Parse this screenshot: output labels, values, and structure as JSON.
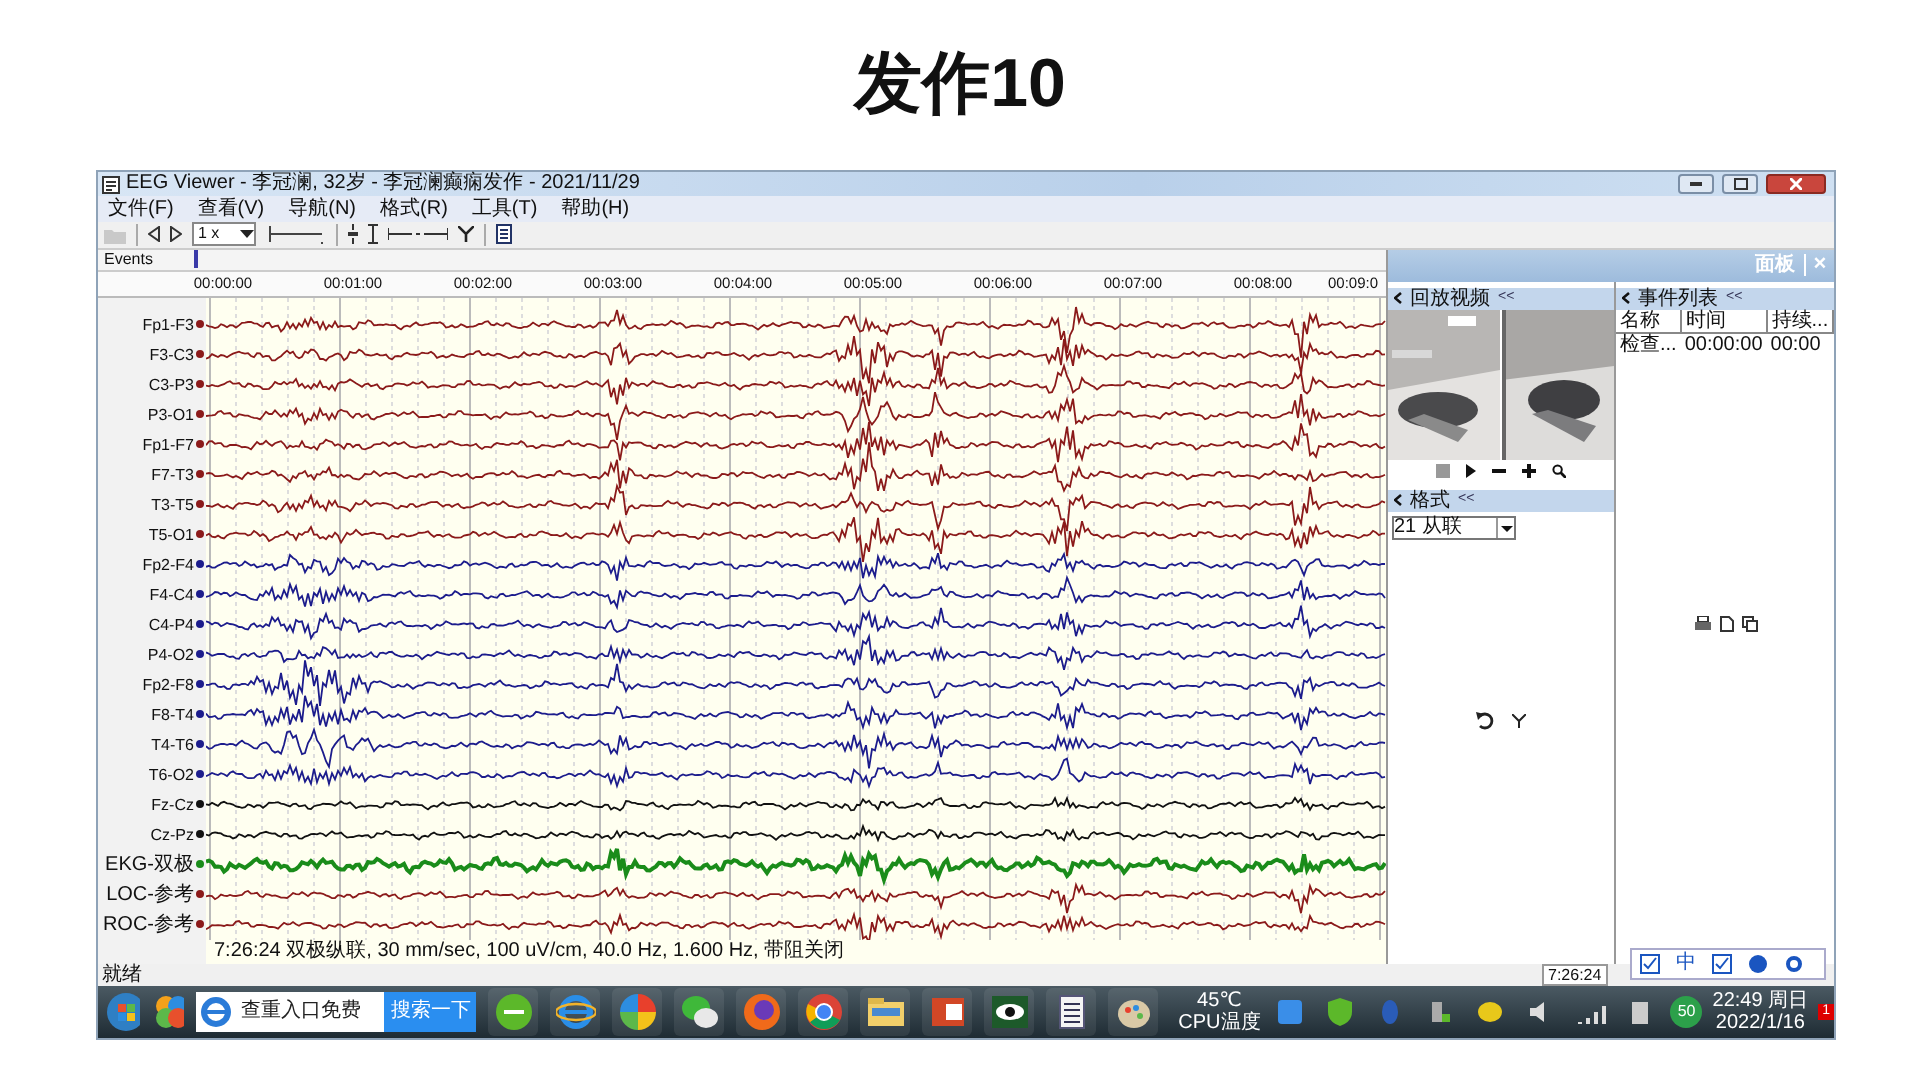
{
  "slide": {
    "title": "发作10"
  },
  "window": {
    "title": "EEG Viewer - 李冠澜, 32岁 - 李冠澜癫痫发作 - 2021/11/29"
  },
  "menu": [
    "文件(F)",
    "查看(V)",
    "导航(N)",
    "格式(R)",
    "工具(T)",
    "帮助(H)"
  ],
  "toolbar": {
    "speed": "1 x"
  },
  "events_row": {
    "label": "Events"
  },
  "time_axis": [
    "00:00:00",
    "00:01:00",
    "00:02:00",
    "00:03:00",
    "00:04:00",
    "00:05:00",
    "00:06:00",
    "00:07:00",
    "00:08:00",
    "00:09:0"
  ],
  "channels": [
    {
      "label": "Fp1-F3",
      "color": "#8b1a1a"
    },
    {
      "label": "F3-C3",
      "color": "#8b1a1a"
    },
    {
      "label": "C3-P3",
      "color": "#8b1a1a"
    },
    {
      "label": "P3-O1",
      "color": "#8b1a1a"
    },
    {
      "label": "Fp1-F7",
      "color": "#8b1a1a"
    },
    {
      "label": "F7-T3",
      "color": "#8b1a1a"
    },
    {
      "label": "T3-T5",
      "color": "#8b1a1a"
    },
    {
      "label": "T5-O1",
      "color": "#8b1a1a"
    },
    {
      "label": "Fp2-F4",
      "color": "#1c1c8c"
    },
    {
      "label": "F4-C4",
      "color": "#1c1c8c"
    },
    {
      "label": "C4-P4",
      "color": "#1c1c8c"
    },
    {
      "label": "P4-O2",
      "color": "#1c1c8c"
    },
    {
      "label": "Fp2-F8",
      "color": "#1c1c8c"
    },
    {
      "label": "F8-T4",
      "color": "#1c1c8c"
    },
    {
      "label": "T4-T6",
      "color": "#1c1c8c"
    },
    {
      "label": "T6-O2",
      "color": "#1c1c8c"
    },
    {
      "label": "Fz-Cz",
      "color": "#111111"
    },
    {
      "label": "Cz-Pz",
      "color": "#111111"
    },
    {
      "label": "EKG-双极",
      "color": "#1a8c1a"
    },
    {
      "label": "LOC-参考",
      "color": "#8b1a1a"
    },
    {
      "label": "ROC-参考",
      "color": "#8b1a1a"
    }
  ],
  "eeg_status": "7:26:24 双极纵联, 30 mm/sec, 100 uV/cm, 40.0 Hz, 1.600 Hz, 带阻关闭",
  "panel": {
    "title": "面板",
    "close": "×",
    "video": {
      "title": "回放视频",
      "collapse": "<<"
    },
    "format": {
      "title": "格式",
      "collapse": "<<",
      "montage": "21 从联"
    },
    "events": {
      "title": "事件列表",
      "collapse": "<<",
      "columns": [
        "名称",
        "时间",
        "持续..."
      ],
      "rows": [
        [
          "检查...",
          "00:00:00",
          "00:00"
        ]
      ]
    }
  },
  "ime_bar": {
    "label": "中"
  },
  "status_bar": {
    "text": "就绪",
    "time": "7:26:24"
  },
  "taskbar": {
    "search_placeholder": "查重入口免费",
    "search_button": "搜索一下",
    "temperature": "45℃",
    "temperature_label": "CPU温度",
    "battery": "50",
    "clock_time": "22:49 周日",
    "clock_date": "2022/1/16",
    "notification_count": "1"
  }
}
